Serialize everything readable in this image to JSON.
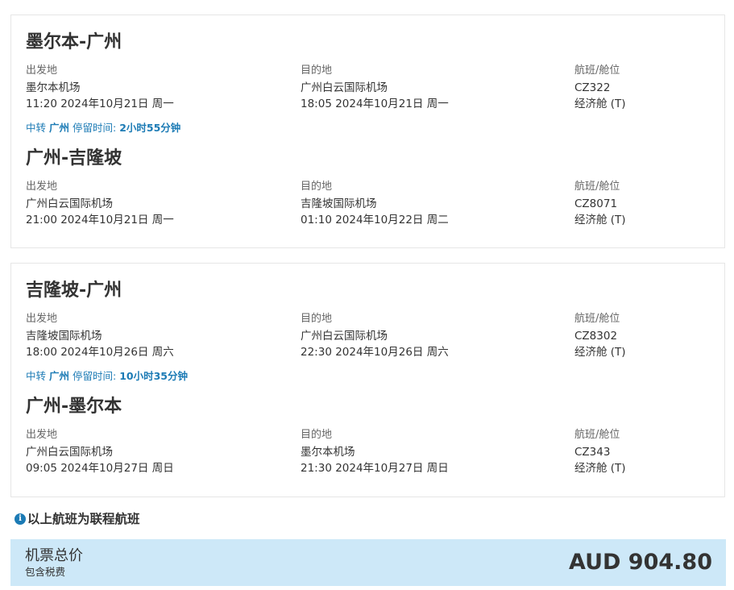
{
  "field_labels": {
    "departure": "出发地",
    "arrival": "目的地",
    "flight": "航班/舱位"
  },
  "outbound": {
    "segments": [
      {
        "title": "墨尔本-广州",
        "dep_airport": "墨尔本机场",
        "dep_time": "11:20 2024年10月21日 周一",
        "arr_airport": "广州白云国际机场",
        "arr_time": "18:05 2024年10月21日 周一",
        "flight_no": "CZ322",
        "cabin": "经济舱 (T)"
      },
      {
        "title": "广州-吉隆坡",
        "dep_airport": "广州白云国际机场",
        "dep_time": "21:00 2024年10月21日 周一",
        "arr_airport": "吉隆坡国际机场",
        "arr_time": "01:10 2024年10月22日 周二",
        "flight_no": "CZ8071",
        "cabin": "经济舱 (T)"
      }
    ],
    "transfer": {
      "prefix": "中转",
      "city": "广州",
      "stay_label": "停留时间:",
      "duration": "2小时55分钟"
    }
  },
  "return": {
    "segments": [
      {
        "title": "吉隆坡-广州",
        "dep_airport": "吉隆坡国际机场",
        "dep_time": "18:00 2024年10月26日 周六",
        "arr_airport": "广州白云国际机场",
        "arr_time": "22:30 2024年10月26日 周六",
        "flight_no": "CZ8302",
        "cabin": "经济舱 (T)"
      },
      {
        "title": "广州-墨尔本",
        "dep_airport": "广州白云国际机场",
        "dep_time": "09:05 2024年10月27日 周日",
        "arr_airport": "墨尔本机场",
        "arr_time": "21:30 2024年10月27日 周日",
        "flight_no": "CZ343",
        "cabin": "经济舱 (T)"
      }
    ],
    "transfer": {
      "prefix": "中转",
      "city": "广州",
      "stay_label": "停留时间:",
      "duration": "10小时35分钟"
    }
  },
  "notice": {
    "icon": "info-icon",
    "text": "以上航班为联程航班"
  },
  "total": {
    "label": "机票总价",
    "sublabel": "包含税费",
    "price": "AUD 904.80"
  },
  "colors": {
    "accent": "#1c7bb5",
    "total_background": "#cde8f8",
    "card_border": "#e6e6e6"
  }
}
